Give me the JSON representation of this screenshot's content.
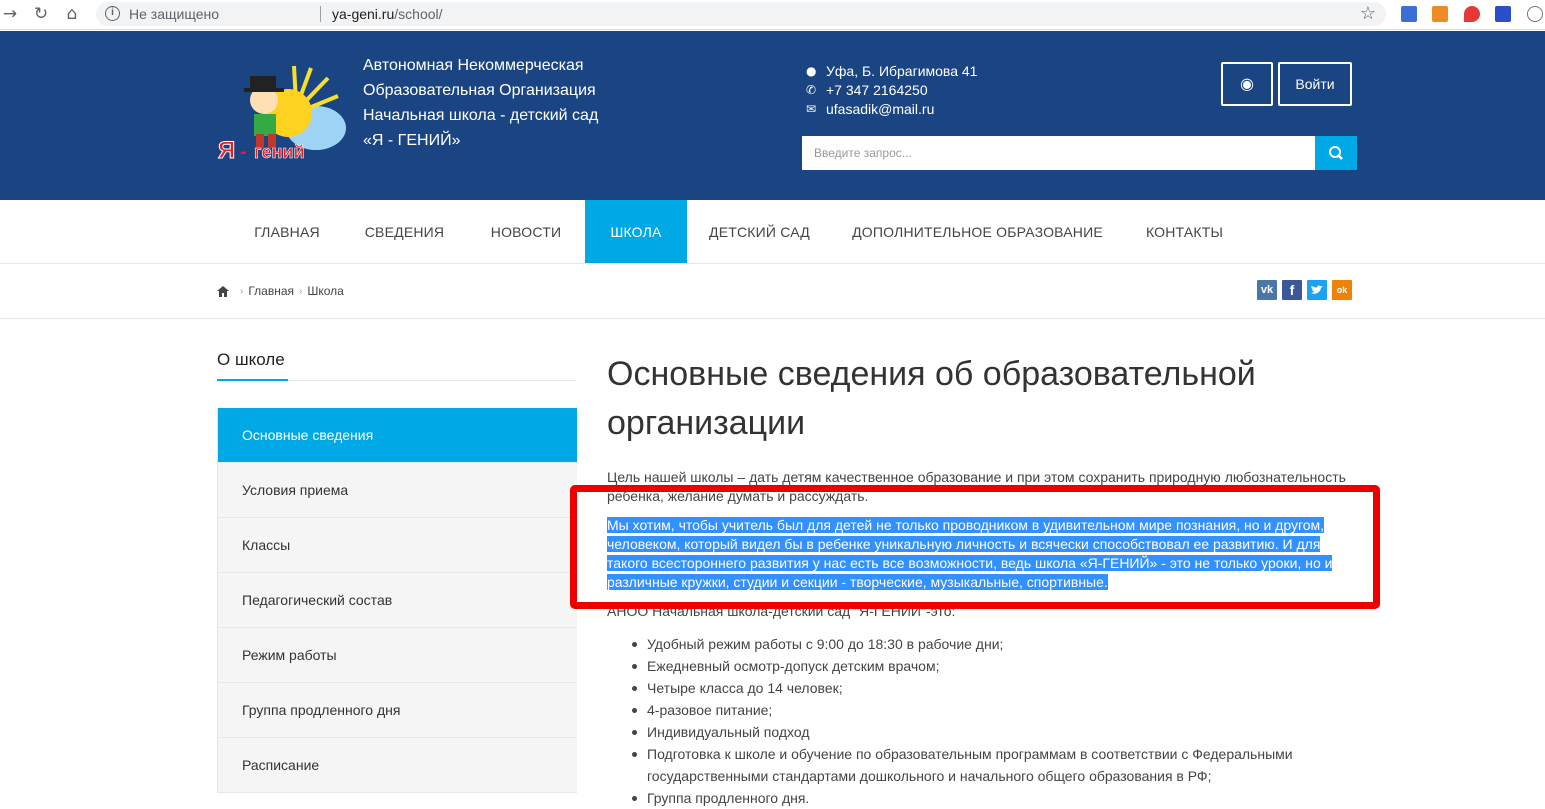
{
  "browser": {
    "security_label": "Не защищено",
    "url_domain": "ya-geni.ru",
    "url_path": "/school/"
  },
  "header": {
    "org_line1": "Автономная Некоммерческая",
    "org_line2": "Образовательная Организация",
    "org_line3": "Начальная школа - детский сад",
    "org_line4": "«Я - ГЕНИЙ»",
    "address": "Уфа, Б. Ибрагимова 41",
    "phone": "+7 347 2164250",
    "email": "ufasadik@mail.ru",
    "login_label": "Войти",
    "search_placeholder": "Введите запрос..."
  },
  "menu": {
    "items": [
      "ГЛАВНАЯ",
      "СВЕДЕНИЯ",
      "НОВОСТИ",
      "ШКОЛА",
      "ДЕТСКИЙ САД",
      "ДОПОЛНИТЕЛЬНОЕ ОБРАЗОВАНИЕ",
      "КОНТАКТЫ"
    ],
    "active": "ШКОЛА"
  },
  "breadcrumb": {
    "home": "Главная",
    "current": "Школа"
  },
  "share": {
    "vk": "vk",
    "fb": "f",
    "ok": "ok"
  },
  "sidebar": {
    "title": "О школе",
    "items": [
      "Основные сведения",
      "Условия приема",
      "Классы",
      "Педагогический состав",
      "Режим работы",
      "Группа продленного дня",
      "Расписание"
    ]
  },
  "content": {
    "title_line1": "Основные сведения об образовательной",
    "title_line2": "организации",
    "para1_line1": "Цель нашей школы – дать детям качественное образование и при этом сохранить природную любознательность",
    "para1_line2": "ребенка, желание думать и рассуждать.",
    "para2_line1": "Мы хотим, чтобы учитель был для детей не только проводником в удивительном мире познания, но и другом,",
    "para2_line2": "человеком, который видел бы в ребенке уникальную личность и всячески способствовал ее развитию. И для",
    "para2_line3": "такого всестороннего развития у нас есть все возможности, ведь школа «Я-ГЕНИЙ» - это не только уроки, но и",
    "para2_line4": "различные кружки, студии и секции - творческие, музыкальные, спортивные.",
    "para3": "АНОО Начальная школа-детский сад \"Я-ГЕНИЙ\"-это:",
    "bullets": [
      "Удобный режим работы с 9:00 до 18:30 в рабочие дни;",
      "Ежедневный осмотр-допуск детским врачом;",
      "Четыре класса до 14 человек;",
      "4-разовое питание;",
      "Индивидуальный подход",
      "Подготовка к школе и обучение по образовательным программам в соответствии с Федеральными",
      "государственными стандартами дошкольного и начального общего образования в РФ;",
      "Группа продленного дня."
    ]
  },
  "colors": {
    "header_bg": "#1b4582",
    "accent": "#00a8e6",
    "highlight": "#3390ff",
    "annotation": "#ee0000"
  }
}
